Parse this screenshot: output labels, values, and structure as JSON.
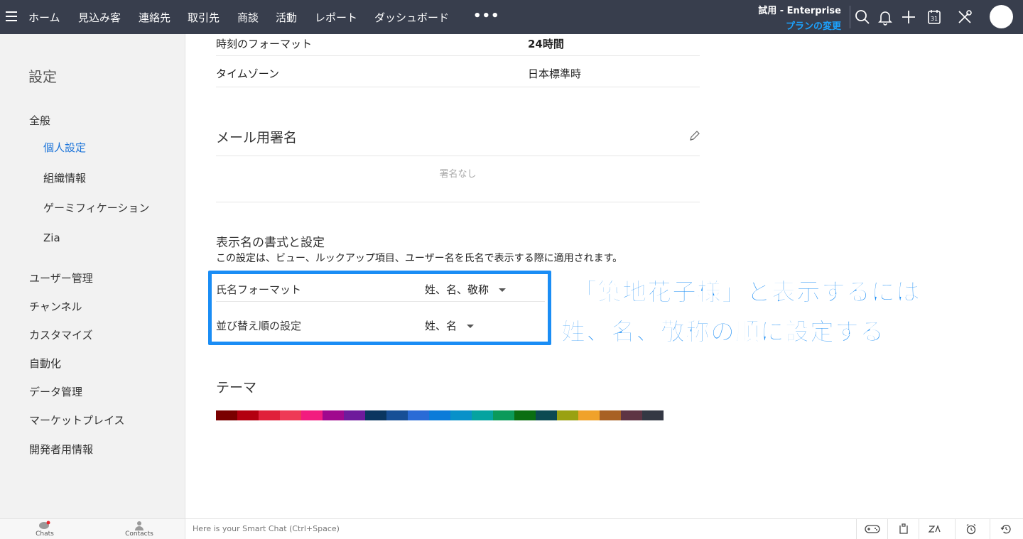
{
  "nav": {
    "items": [
      "ホーム",
      "見込み客",
      "連絡先",
      "取引先",
      "商談",
      "活動",
      "レポート",
      "ダッシュボード"
    ],
    "more_label": "•••",
    "trial_label": "試用 - Enterprise",
    "plan_label": "プランの変更",
    "calendar_day": "31"
  },
  "sidebar": {
    "title": "設定",
    "group_general": "全般",
    "sub_items": [
      "個人設定",
      "組織情報",
      "ゲーミフィケーション",
      "Zia"
    ],
    "items": [
      "ユーザー管理",
      "チャンネル",
      "カスタマイズ",
      "自動化",
      "データ管理",
      "マーケットプレイス",
      "開発者用情報"
    ]
  },
  "main": {
    "time_format_label": "時刻のフォーマット",
    "time_format_value": "24時間",
    "timezone_label": "タイムゾーン",
    "timezone_value": "日本標準時",
    "signature_title": "メール用署名",
    "signature_empty": "署名なし",
    "display_name_title": "表示名の書式と設定",
    "display_name_desc": "この設定は、ビュー、ルックアップ項目、ユーザー名を氏名で表示する際に適用されます。",
    "name_format_label": "氏名フォーマット",
    "name_format_value": "姓、名、敬称",
    "sort_order_label": "並び替え順の設定",
    "sort_order_value": "姓、名",
    "theme_title": "テーマ",
    "theme_colors": [
      "#7a0000",
      "#b30010",
      "#e0203a",
      "#ee3a56",
      "#f21c7f",
      "#a0088e",
      "#6e1b9c",
      "#0a3660",
      "#174f96",
      "#2a6bd6",
      "#0a7bd9",
      "#0891c9",
      "#05a3a0",
      "#0b9a5a",
      "#0a6e12",
      "#0c4a52",
      "#9aa112",
      "#f0a22a",
      "#a86124",
      "#5e3444",
      "#343844"
    ]
  },
  "annotation": {
    "line1": "「築地花子様」と表示するには",
    "line2": "姓、名、敬称の順に設定する"
  },
  "bottom": {
    "chats_label": "Chats",
    "contacts_label": "Contacts",
    "smart_chat_placeholder": "Here is your Smart Chat (Ctrl+Space)"
  }
}
